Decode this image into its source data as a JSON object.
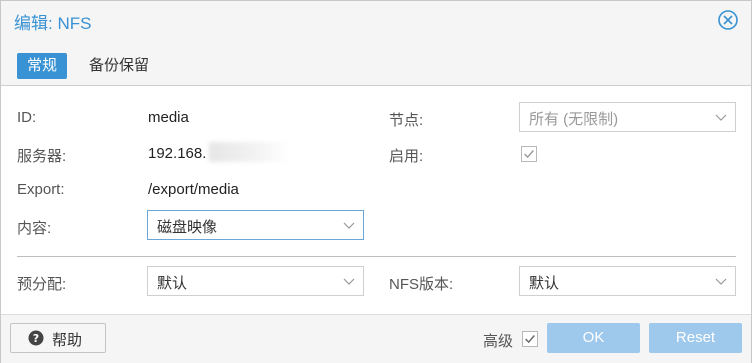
{
  "window": {
    "title": "编辑: NFS"
  },
  "tabs": [
    {
      "label": "常规",
      "active": true
    },
    {
      "label": "备份保留",
      "active": false
    }
  ],
  "form": {
    "id_label": "ID:",
    "id_value": "media",
    "server_label": "服务器:",
    "server_value": "192.168.",
    "export_label": "Export:",
    "export_value": "/export/media",
    "content_label": "内容:",
    "content_value": "磁盘映像",
    "node_label": "节点:",
    "node_value": "所有 (无限制)",
    "enable_label": "启用:",
    "enable_checked": true,
    "prealloc_label": "预分配:",
    "prealloc_value": "默认",
    "nfs_version_label": "NFS版本:",
    "nfs_version_value": "默认"
  },
  "footer": {
    "help_label": "帮助",
    "advanced_label": "高级",
    "advanced_checked": true,
    "ok_label": "OK",
    "reset_label": "Reset"
  },
  "colors": {
    "accent": "#3892d4",
    "button_disabled": "#9ec8ec"
  }
}
